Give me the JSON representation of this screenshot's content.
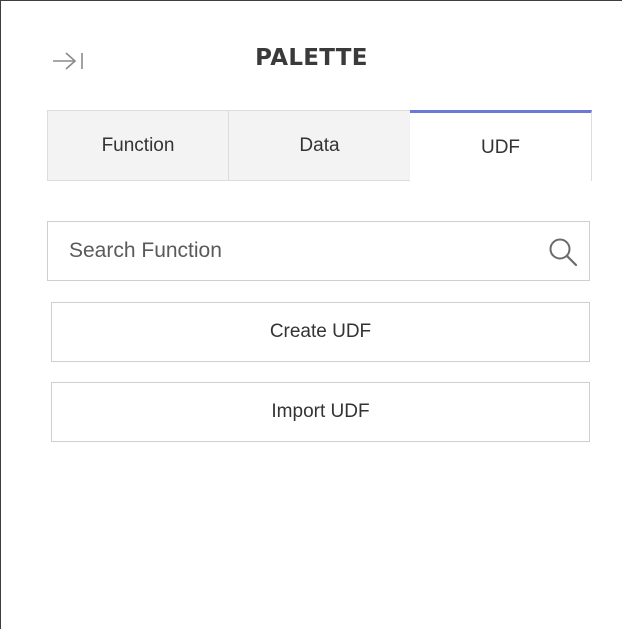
{
  "palette": {
    "title": "PALETTE",
    "collapse_icon": "collapse-right-icon",
    "tabs": [
      {
        "label": "Function",
        "active": false
      },
      {
        "label": "Data",
        "active": false
      },
      {
        "label": "UDF",
        "active": true
      }
    ],
    "search": {
      "placeholder": "Search Function",
      "value": "",
      "icon": "search-icon"
    },
    "buttons": {
      "create_label": "Create UDF",
      "import_label": "Import UDF"
    },
    "colors": {
      "active_tab_accent": "#6a79d6",
      "inactive_tab_bg": "#f3f3f3",
      "border": "#cfcfcf"
    }
  }
}
